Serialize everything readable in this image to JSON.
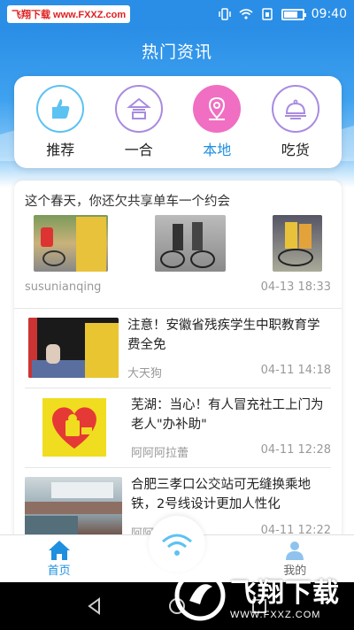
{
  "status_bar": {
    "watermark": "飞翔下载 www.FXXZ.com",
    "time": "09:40"
  },
  "header": {
    "title": "热门资讯"
  },
  "categories": [
    {
      "label": "推荐",
      "icon": "thumbs-up-icon",
      "active": false
    },
    {
      "label": "一合",
      "icon": "combine-icon",
      "active": false
    },
    {
      "label": "本地",
      "icon": "location-pin-icon",
      "active": true
    },
    {
      "label": "吃货",
      "icon": "food-cloche-icon",
      "active": false
    }
  ],
  "feature": {
    "title": "这个春天，你还欠共享单车一个约会",
    "author": "susunianqing",
    "time": "04-13 18:33"
  },
  "news": [
    {
      "title": "注意！安徽省残疾学生中职教育学费全免",
      "source": "大天狗",
      "time": "04-11 14:18"
    },
    {
      "title": "芜湖：当心！有人冒充社工上门为老人\"办补助\"",
      "source": "阿阿阿拉蕾",
      "time": "04-11 12:28"
    },
    {
      "title": "合肥三孝口公交站可无缝换乘地铁，2号线设计更加人性化",
      "source": "阿阿",
      "time": "04-11 12:22"
    }
  ],
  "bottom_nav": {
    "home": "首页",
    "center": "W",
    "mine": "我的"
  },
  "watermark_bottom": {
    "brand": "飞翔下载",
    "url": "WWW.FXXZ.COM"
  },
  "colors": {
    "accent": "#1f8fe0",
    "header_blue": "#2a8ee6",
    "active_pink": "#f06fc2"
  }
}
